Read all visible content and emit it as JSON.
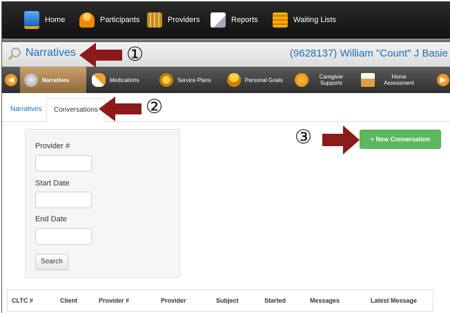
{
  "topnav": {
    "items": [
      {
        "label": "Home",
        "icon": "monitor-icon"
      },
      {
        "label": "Participants",
        "icon": "person-icon"
      },
      {
        "label": "Providers",
        "icon": "building-icon"
      },
      {
        "label": "Reports",
        "icon": "documents-icon"
      },
      {
        "label": "Waiting Lists",
        "icon": "list-icon"
      }
    ]
  },
  "titlebar": {
    "title": "Narratives",
    "client": "(9628137) William \"Count\" J Basie"
  },
  "modules": {
    "items": [
      {
        "label": "Narratives",
        "active": true
      },
      {
        "label": "Medications"
      },
      {
        "label": "Service Plans"
      },
      {
        "label": "Personal Goals"
      },
      {
        "label": "Caregiver Supports"
      },
      {
        "label": "Home Assessment"
      }
    ]
  },
  "tabs": {
    "narratives": "Narratives",
    "conversations": "Conversations"
  },
  "search": {
    "provider_label": "Provider #",
    "start_label": "Start Date",
    "end_label": "End Date",
    "button": "Search"
  },
  "new_conversation": "+ New Conversation",
  "table": {
    "headers": [
      "CLTC #",
      "Client",
      "Provider #",
      "Provider",
      "Subject",
      "Started",
      "Messages",
      "Latest Message"
    ]
  },
  "annotations": {
    "one": "①",
    "two": "②",
    "three": "③",
    "arrow_color": "#8b1a1a"
  },
  "colors": {
    "accent": "#1d6fb8",
    "success": "#5cb85c"
  }
}
